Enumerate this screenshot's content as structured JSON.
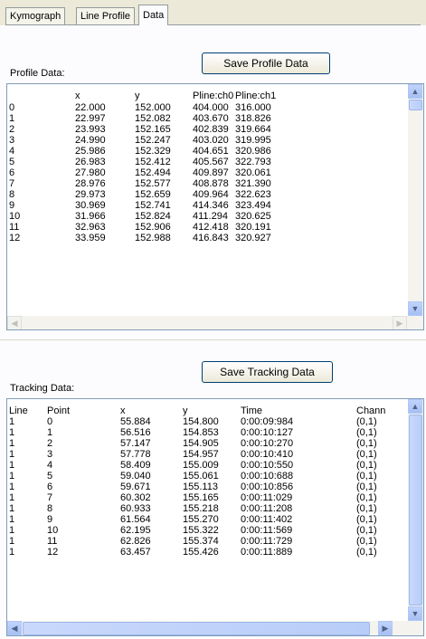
{
  "tabs": [
    "Kymograph",
    "Line Profile",
    "Data"
  ],
  "active_tab": "Data",
  "profile": {
    "label": "Profile Data:",
    "save_button": "Save Profile Data",
    "headers": [
      "",
      "x",
      "y",
      "Pline:ch0",
      "Pline:ch1"
    ],
    "rows": [
      [
        "0",
        "22.000",
        "152.000",
        "404.000",
        "316.000"
      ],
      [
        "1",
        "22.997",
        "152.082",
        "403.670",
        "318.826"
      ],
      [
        "2",
        "23.993",
        "152.165",
        "402.839",
        "319.664"
      ],
      [
        "3",
        "24.990",
        "152.247",
        "403.020",
        "319.995"
      ],
      [
        "4",
        "25.986",
        "152.329",
        "404.651",
        "320.986"
      ],
      [
        "5",
        "26.983",
        "152.412",
        "405.567",
        "322.793"
      ],
      [
        "6",
        "27.980",
        "152.494",
        "409.897",
        "320.061"
      ],
      [
        "7",
        "28.976",
        "152.577",
        "408.878",
        "321.390"
      ],
      [
        "8",
        "29.973",
        "152.659",
        "409.964",
        "322.623"
      ],
      [
        "9",
        "30.969",
        "152.741",
        "414.346",
        "323.494"
      ],
      [
        "10",
        "31.966",
        "152.824",
        "411.294",
        "320.625"
      ],
      [
        "11",
        "32.963",
        "152.906",
        "412.418",
        "320.191"
      ],
      [
        "12",
        "33.959",
        "152.988",
        "416.843",
        "320.927"
      ]
    ]
  },
  "tracking": {
    "label": "Tracking Data:",
    "save_button": "Save Tracking Data",
    "headers": [
      "Line",
      "Point",
      "x",
      "y",
      "Time",
      "Chann",
      ""
    ],
    "rows": [
      [
        "1",
        "0",
        "55.884",
        "154.800",
        "0:00:09:984",
        "(0,1)"
      ],
      [
        "1",
        "1",
        "56.516",
        "154.853",
        "0:00:10:127",
        "(0,1)"
      ],
      [
        "1",
        "2",
        "57.147",
        "154.905",
        "0:00:10:270",
        "(0,1)"
      ],
      [
        "1",
        "3",
        "57.778",
        "154.957",
        "0:00:10:410",
        "(0,1)"
      ],
      [
        "1",
        "4",
        "58.409",
        "155.009",
        "0:00:10:550",
        "(0,1)"
      ],
      [
        "1",
        "5",
        "59.040",
        "155.061",
        "0:00:10:688",
        "(0,1)"
      ],
      [
        "1",
        "6",
        "59.671",
        "155.113",
        "0:00:10:856",
        "(0,1)"
      ],
      [
        "1",
        "7",
        "60.302",
        "155.165",
        "0:00:11:029",
        "(0,1)"
      ],
      [
        "1",
        "8",
        "60.933",
        "155.218",
        "0:00:11:208",
        "(0,1)"
      ],
      [
        "1",
        "9",
        "61.564",
        "155.270",
        "0:00:11:402",
        "(0,1)"
      ],
      [
        "1",
        "10",
        "62.195",
        "155.322",
        "0:00:11:569",
        "(0,1)"
      ],
      [
        "1",
        "11",
        "62.826",
        "155.374",
        "0:00:11:729",
        "(0,1)"
      ],
      [
        "1",
        "12",
        "63.457",
        "155.426",
        "0:00:11:889",
        "(0,1)"
      ]
    ]
  },
  "icons": {
    "up": "▲",
    "down": "▼",
    "left": "◀",
    "right": "▶"
  }
}
